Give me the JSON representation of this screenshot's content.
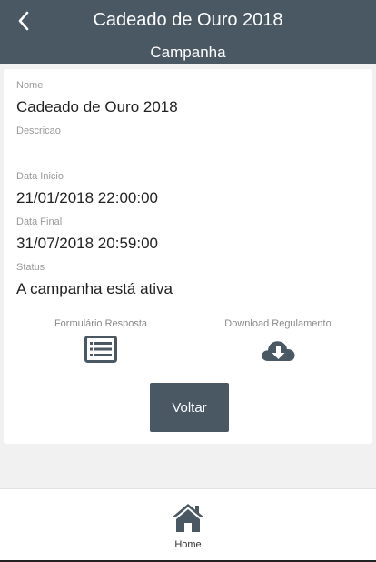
{
  "header": {
    "title": "Cadeado de Ouro 2018",
    "subtitle": "Campanha"
  },
  "fields": {
    "nome": {
      "label": "Nome",
      "value": "Cadeado de Ouro 2018"
    },
    "descricao": {
      "label": "Descricao",
      "value": ""
    },
    "data_inicio": {
      "label": "Data Inicio",
      "value": "21/01/2018 22:00:00"
    },
    "data_final": {
      "label": "Data Final",
      "value": "31/07/2018 20:59:00"
    },
    "status": {
      "label": "Status",
      "value": "A campanha está ativa"
    }
  },
  "actions": {
    "formulario": {
      "label": "Formulário Resposta",
      "icon": "list-icon"
    },
    "download": {
      "label": "Download Regulamento",
      "icon": "cloud-download-icon"
    }
  },
  "buttons": {
    "voltar": "Voltar"
  },
  "bottom_nav": {
    "home_label": "Home",
    "icon": "home-icon"
  },
  "colors": {
    "primary": "#4a5864",
    "background": "#f1f1f1"
  }
}
